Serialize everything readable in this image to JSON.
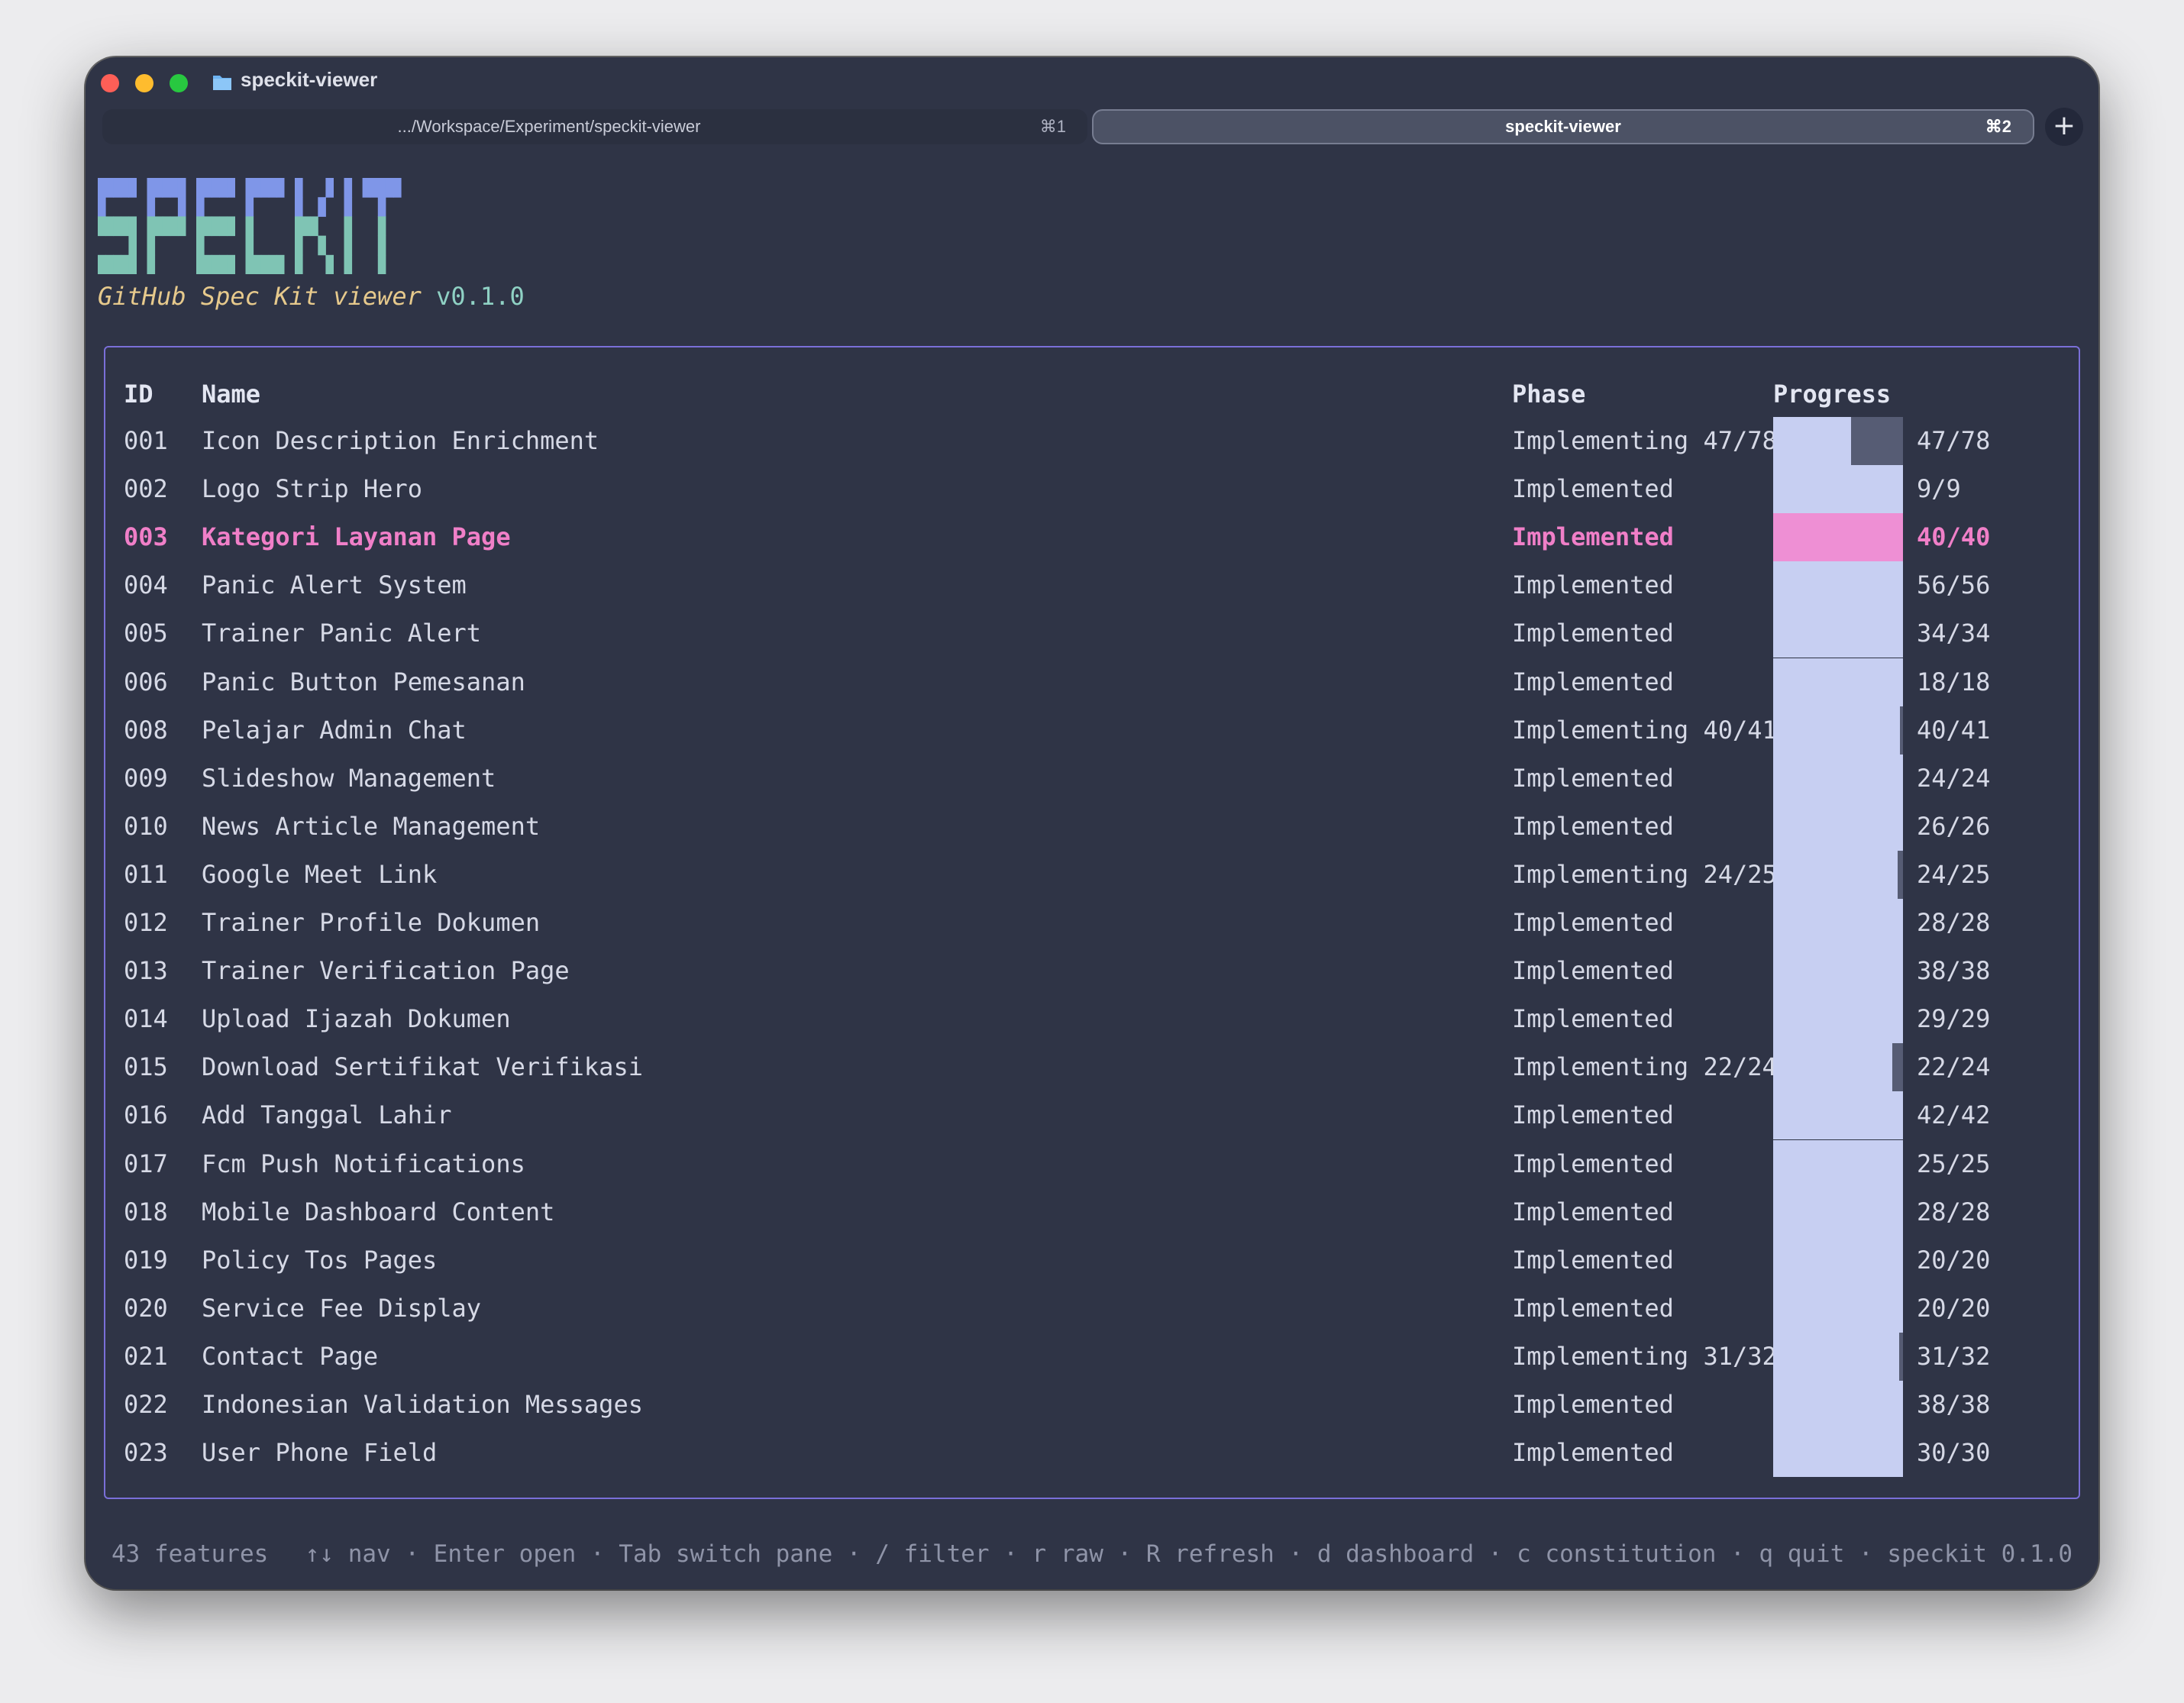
{
  "window": {
    "title": "speckit-viewer"
  },
  "tabs": [
    {
      "label": ".../Workspace/Experiment/speckit-viewer",
      "shortcut": "⌘1",
      "active": false
    },
    {
      "label": "speckit-viewer",
      "shortcut": "⌘2",
      "active": true
    }
  ],
  "new_tab_label": "+",
  "header": {
    "logo_text": "SPECKIT",
    "subtitle": "GitHub Spec Kit viewer",
    "version": "v0.1.0"
  },
  "table": {
    "columns": [
      "ID",
      "Name",
      "Phase",
      "Progress"
    ],
    "selected_id": "003",
    "rows": [
      {
        "id": "001",
        "name": "Icon Description Enrichment",
        "phase": "Implementing 47/78",
        "done": 47,
        "total": 78,
        "count": "47/78"
      },
      {
        "id": "002",
        "name": "Logo Strip Hero",
        "phase": "Implemented",
        "done": 9,
        "total": 9,
        "count": "9/9"
      },
      {
        "id": "003",
        "name": "Kategori Layanan Page",
        "phase": "Implemented",
        "done": 40,
        "total": 40,
        "count": "40/40"
      },
      {
        "id": "004",
        "name": "Panic Alert System",
        "phase": "Implemented",
        "done": 56,
        "total": 56,
        "count": "56/56"
      },
      {
        "id": "005",
        "name": "Trainer Panic Alert",
        "phase": "Implemented",
        "done": 34,
        "total": 34,
        "count": "34/34"
      },
      {
        "id": "006",
        "name": "Panic Button Pemesanan",
        "phase": "Implemented",
        "done": 18,
        "total": 18,
        "count": "18/18"
      },
      {
        "id": "008",
        "name": "Pelajar Admin Chat",
        "phase": "Implementing 40/41",
        "done": 40,
        "total": 41,
        "count": "40/41"
      },
      {
        "id": "009",
        "name": "Slideshow Management",
        "phase": "Implemented",
        "done": 24,
        "total": 24,
        "count": "24/24"
      },
      {
        "id": "010",
        "name": "News Article Management",
        "phase": "Implemented",
        "done": 26,
        "total": 26,
        "count": "26/26"
      },
      {
        "id": "011",
        "name": "Google Meet Link",
        "phase": "Implementing 24/25",
        "done": 24,
        "total": 25,
        "count": "24/25"
      },
      {
        "id": "012",
        "name": "Trainer Profile Dokumen",
        "phase": "Implemented",
        "done": 28,
        "total": 28,
        "count": "28/28"
      },
      {
        "id": "013",
        "name": "Trainer Verification Page",
        "phase": "Implemented",
        "done": 38,
        "total": 38,
        "count": "38/38"
      },
      {
        "id": "014",
        "name": "Upload Ijazah Dokumen",
        "phase": "Implemented",
        "done": 29,
        "total": 29,
        "count": "29/29"
      },
      {
        "id": "015",
        "name": "Download Sertifikat Verifikasi",
        "phase": "Implementing 22/24",
        "done": 22,
        "total": 24,
        "count": "22/24"
      },
      {
        "id": "016",
        "name": "Add Tanggal Lahir",
        "phase": "Implemented",
        "done": 42,
        "total": 42,
        "count": "42/42"
      },
      {
        "id": "017",
        "name": "Fcm Push Notifications",
        "phase": "Implemented",
        "done": 25,
        "total": 25,
        "count": "25/25"
      },
      {
        "id": "018",
        "name": "Mobile Dashboard Content",
        "phase": "Implemented",
        "done": 28,
        "total": 28,
        "count": "28/28"
      },
      {
        "id": "019",
        "name": "Policy Tos Pages",
        "phase": "Implemented",
        "done": 20,
        "total": 20,
        "count": "20/20"
      },
      {
        "id": "020",
        "name": "Service Fee Display",
        "phase": "Implemented",
        "done": 20,
        "total": 20,
        "count": "20/20"
      },
      {
        "id": "021",
        "name": "Contact Page",
        "phase": "Implementing 31/32",
        "done": 31,
        "total": 32,
        "count": "31/32"
      },
      {
        "id": "022",
        "name": "Indonesian Validation Messages",
        "phase": "Implemented",
        "done": 38,
        "total": 38,
        "count": "38/38"
      },
      {
        "id": "023",
        "name": "User Phone Field",
        "phase": "Implemented",
        "done": 30,
        "total": 30,
        "count": "30/30"
      }
    ]
  },
  "footer": {
    "count_text": "43 features",
    "help_text": "↑↓ nav · Enter open · Tab switch pane · / filter · r raw · R refresh · d dashboard · c constitution · q quit · speckit 0.1.0"
  },
  "colors": {
    "background": "#2f3446",
    "accent_border": "#7a6fd8",
    "selected": "#f07fc8",
    "bar_fill": "#c7cff2",
    "bar_track": "#565c74",
    "subtitle": "#e6c98c",
    "version": "#8fd1c4",
    "logo_top": "#7f96e8",
    "logo_bottom": "#7fc4b4"
  },
  "icons": {
    "close": "red-circle",
    "minimize": "yellow-circle",
    "zoom": "green-circle",
    "folder": "folder-icon"
  }
}
